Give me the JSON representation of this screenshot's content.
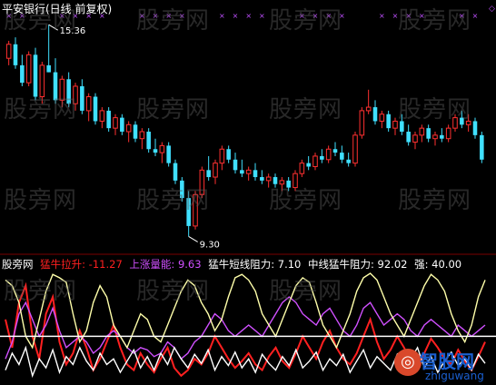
{
  "title": "平安银行(日线 前复权)",
  "watermark": "股旁网",
  "price_labels": {
    "high": "15.36",
    "low": "9.30"
  },
  "indicators": [
    {
      "label": "股旁网",
      "color": "#ffffff"
    },
    {
      "label": "猛牛拉升: -11.27",
      "color": "#ff2020"
    },
    {
      "label": "上涨量能: 9.63",
      "color": "#d050ff"
    },
    {
      "label": "猛牛短线阻力: 7.10",
      "color": "#ffffff"
    },
    {
      "label": "中线猛牛阻力: 92.02",
      "color": "#ffffff"
    },
    {
      "label": "强: 40.00",
      "color": "#ffffff"
    }
  ],
  "logo": {
    "main": "智股网",
    "sub": "zhiguwang"
  },
  "colors": {
    "up": "#ff3030",
    "down": "#40e0ff",
    "marker": "#c050ff",
    "reference": "#ffffff"
  },
  "chart_data": {
    "type": "candlestick",
    "price_range": [
      9.0,
      15.6
    ],
    "candles": [
      [
        14.4,
        14.9,
        14.2,
        14.8
      ],
      [
        14.8,
        15.0,
        14.1,
        14.2
      ],
      [
        14.2,
        14.5,
        13.6,
        13.7
      ],
      [
        13.7,
        14.6,
        13.6,
        14.5
      ],
      [
        14.5,
        14.7,
        13.2,
        13.3
      ],
      [
        13.3,
        14.3,
        13.1,
        14.2
      ],
      [
        14.2,
        15.36,
        14.0,
        14.0
      ],
      [
        14.0,
        14.4,
        13.1,
        13.2
      ],
      [
        13.2,
        13.9,
        13.0,
        13.8
      ],
      [
        13.8,
        14.0,
        13.0,
        13.1
      ],
      [
        13.1,
        13.7,
        12.9,
        13.6
      ],
      [
        13.6,
        13.8,
        12.8,
        12.9
      ],
      [
        12.9,
        13.4,
        12.6,
        13.3
      ],
      [
        13.3,
        13.4,
        12.5,
        12.6
      ],
      [
        12.6,
        13.0,
        12.4,
        12.9
      ],
      [
        12.9,
        13.0,
        12.3,
        12.4
      ],
      [
        12.4,
        12.8,
        12.2,
        12.7
      ],
      [
        12.7,
        12.8,
        12.2,
        12.3
      ],
      [
        12.3,
        12.6,
        12.0,
        12.5
      ],
      [
        12.5,
        12.6,
        12.0,
        12.1
      ],
      [
        12.1,
        12.4,
        11.8,
        12.3
      ],
      [
        12.3,
        12.4,
        11.7,
        11.8
      ],
      [
        11.8,
        12.1,
        11.6,
        11.7
      ],
      [
        11.7,
        12.0,
        11.4,
        11.9
      ],
      [
        11.9,
        12.0,
        11.3,
        11.4
      ],
      [
        11.4,
        11.5,
        10.8,
        10.9
      ],
      [
        10.9,
        11.0,
        10.3,
        10.4
      ],
      [
        10.4,
        10.6,
        9.3,
        9.6
      ],
      [
        9.6,
        10.6,
        9.5,
        10.5
      ],
      [
        10.5,
        11.3,
        10.4,
        11.2
      ],
      [
        11.2,
        11.6,
        10.9,
        11.0
      ],
      [
        11.0,
        11.5,
        10.8,
        11.4
      ],
      [
        11.4,
        11.9,
        11.2,
        11.8
      ],
      [
        11.8,
        11.9,
        11.4,
        11.5
      ],
      [
        11.5,
        11.7,
        11.1,
        11.2
      ],
      [
        11.2,
        11.5,
        11.0,
        11.1
      ],
      [
        11.1,
        11.3,
        10.9,
        11.2
      ],
      [
        11.2,
        11.4,
        10.9,
        11.0
      ],
      [
        11.0,
        11.2,
        10.8,
        10.9
      ],
      [
        10.9,
        11.1,
        10.7,
        11.0
      ],
      [
        11.0,
        11.1,
        10.7,
        10.8
      ],
      [
        10.8,
        11.0,
        10.6,
        10.9
      ],
      [
        10.9,
        11.0,
        10.6,
        10.7
      ],
      [
        10.7,
        11.2,
        10.6,
        11.1
      ],
      [
        11.1,
        11.5,
        11.0,
        11.4
      ],
      [
        11.4,
        11.6,
        11.2,
        11.3
      ],
      [
        11.3,
        11.7,
        11.2,
        11.6
      ],
      [
        11.6,
        11.8,
        11.4,
        11.5
      ],
      [
        11.5,
        11.9,
        11.4,
        11.8
      ],
      [
        11.8,
        12.0,
        11.6,
        11.7
      ],
      [
        11.7,
        11.9,
        11.4,
        11.5
      ],
      [
        11.5,
        11.7,
        11.3,
        11.4
      ],
      [
        11.4,
        12.3,
        11.3,
        12.2
      ],
      [
        12.2,
        13.0,
        12.1,
        12.9
      ],
      [
        12.9,
        13.5,
        12.8,
        13.0
      ],
      [
        13.0,
        13.2,
        12.5,
        12.6
      ],
      [
        12.6,
        12.9,
        12.4,
        12.8
      ],
      [
        12.8,
        12.9,
        12.3,
        12.4
      ],
      [
        12.4,
        12.7,
        12.2,
        12.6
      ],
      [
        12.6,
        12.8,
        12.2,
        12.3
      ],
      [
        12.3,
        12.5,
        11.9,
        12.0
      ],
      [
        12.0,
        12.3,
        11.8,
        12.2
      ],
      [
        12.2,
        12.5,
        12.0,
        12.4
      ],
      [
        12.4,
        12.5,
        12.0,
        12.1
      ],
      [
        12.1,
        12.3,
        11.9,
        12.2
      ],
      [
        12.2,
        12.4,
        12.0,
        12.1
      ],
      [
        12.1,
        12.5,
        12.0,
        12.4
      ],
      [
        12.4,
        12.8,
        12.3,
        12.7
      ],
      [
        12.7,
        12.9,
        12.4,
        12.5
      ],
      [
        12.5,
        12.8,
        12.3,
        12.6
      ],
      [
        12.6,
        12.7,
        12.1,
        12.2
      ],
      [
        12.2,
        12.3,
        11.4,
        11.5
      ]
    ],
    "series": [
      {
        "name": "猛牛拉升",
        "color": "#ff2020",
        "range": [
          0,
          100
        ],
        "values": [
          55,
          30,
          70,
          85,
          40,
          20,
          60,
          75,
          35,
          15,
          25,
          45,
          30,
          10,
          20,
          35,
          50,
          30,
          15,
          10,
          25,
          15,
          8,
          20,
          30,
          12,
          5,
          10,
          20,
          15,
          25,
          40,
          30,
          20,
          12,
          18,
          25,
          15,
          10,
          22,
          30,
          18,
          12,
          25,
          40,
          30,
          20,
          35,
          45,
          30,
          20,
          15,
          25,
          40,
          55,
          35,
          20,
          28,
          40,
          30,
          18,
          12,
          25,
          38,
          30,
          20,
          15,
          28,
          18,
          10,
          22,
          35
        ]
      },
      {
        "name": "上涨量能",
        "color": "#d050ff",
        "range": [
          0,
          100
        ],
        "values": [
          20,
          35,
          60,
          70,
          55,
          40,
          50,
          65,
          45,
          30,
          35,
          40,
          35,
          25,
          30,
          40,
          45,
          40,
          30,
          25,
          30,
          28,
          22,
          25,
          35,
          30,
          20,
          25,
          35,
          40,
          50,
          60,
          55,
          45,
          40,
          45,
          50,
          45,
          40,
          50,
          60,
          70,
          75,
          70,
          60,
          55,
          50,
          60,
          65,
          55,
          45,
          40,
          50,
          65,
          70,
          60,
          50,
          55,
          60,
          55,
          45,
          40,
          50,
          55,
          50,
          45,
          40,
          50,
          45,
          40,
          45,
          50
        ]
      },
      {
        "name": "猛牛短线阻力",
        "color": "#ffffff",
        "range": [
          0,
          100
        ],
        "values": [
          10,
          25,
          15,
          30,
          5,
          20,
          12,
          28,
          8,
          22,
          15,
          30,
          18,
          10,
          25,
          15,
          20,
          8,
          18,
          28,
          12,
          22,
          10,
          25,
          15,
          30,
          20,
          12,
          24,
          16,
          28,
          10,
          22,
          14,
          26,
          12,
          20,
          8,
          24,
          16,
          10,
          22,
          14,
          28,
          12,
          18,
          26,
          10,
          20,
          14,
          24,
          8,
          18,
          28,
          12,
          22,
          16,
          10,
          24,
          14,
          20,
          30,
          12,
          22,
          8,
          18,
          26,
          14,
          20,
          10,
          24,
          16
        ]
      },
      {
        "name": "中线猛牛阻力",
        "color": "#ffffaa",
        "range": [
          0,
          100
        ],
        "values": [
          90,
          85,
          70,
          40,
          30,
          55,
          80,
          95,
          92,
          88,
          60,
          35,
          45,
          70,
          85,
          75,
          50,
          40,
          30,
          45,
          60,
          55,
          40,
          35,
          50,
          65,
          80,
          90,
          85,
          70,
          60,
          45,
          55,
          75,
          92,
          95,
          90,
          80,
          60,
          50,
          40,
          55,
          70,
          85,
          92,
          88,
          70,
          50,
          40,
          30,
          45,
          60,
          80,
          92,
          96,
          90,
          75,
          60,
          50,
          40,
          55,
          70,
          85,
          95,
          90,
          80,
          60,
          45,
          35,
          50,
          75,
          90
        ]
      },
      {
        "name": "强",
        "color": "#ffffff",
        "range": [
          0,
          100
        ],
        "values": [
          40
        ],
        "reference": true
      }
    ]
  }
}
